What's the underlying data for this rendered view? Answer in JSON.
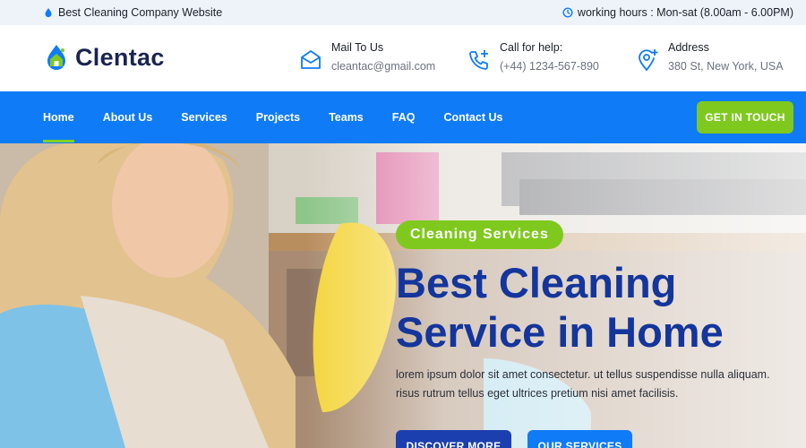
{
  "topbar": {
    "tagline": "Best Cleaning Company Website",
    "hours": "working hours : Mon-sat (8.00am - 6.00PM)"
  },
  "brand": {
    "name": "Clentac"
  },
  "contacts": {
    "mail": {
      "title": "Mail To Us",
      "value": "cleantac@gmail.com"
    },
    "phone": {
      "title": "Call for help:",
      "value": "(+44) 1234-567-890"
    },
    "address": {
      "title": "Address",
      "value": "380 St, New York, USA"
    }
  },
  "nav": {
    "items": [
      "Home",
      "About Us",
      "Services",
      "Projects",
      "Teams",
      "FAQ",
      "Contact Us"
    ],
    "active": "Home",
    "cta": "GET IN TOUCH"
  },
  "hero": {
    "badge": "Cleaning Services",
    "headline_line1": "Best Cleaning",
    "headline_line2": "Service in Home",
    "description": "lorem ipsum dolor sit amet consectetur. ut tellus suspendisse nulla aliquam. risus rutrum tellus eget ultrices pretium nisi amet facilisis.",
    "primary_button": "DISCOVER MORE",
    "secondary_button": "OUR SERVICES"
  },
  "colors": {
    "nav_blue": "#0f7bf7",
    "accent_green": "#7fc91f",
    "heading_navy": "#14359b"
  }
}
